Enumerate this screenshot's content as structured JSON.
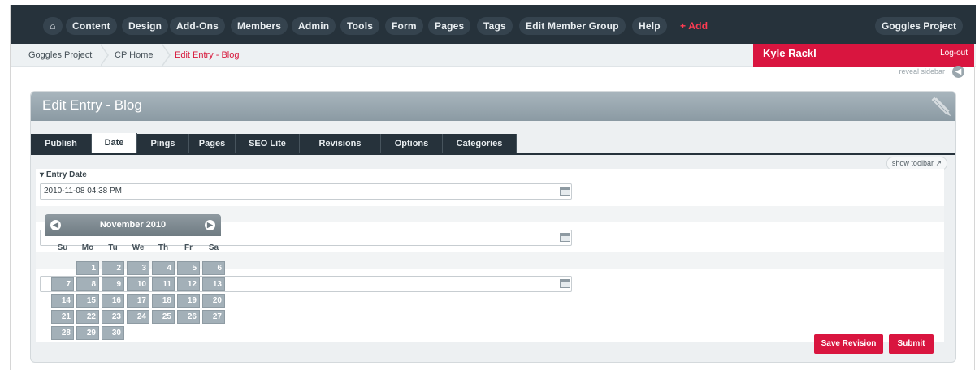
{
  "topnav": {
    "home_icon": "home-icon",
    "items": [
      "Content",
      "Design",
      "Add-Ons",
      "Members",
      "Admin",
      "Tools",
      "Form",
      "Pages",
      "Tags",
      "Edit Member Group",
      "Help"
    ],
    "add_label": "+ Add",
    "project": "Goggles Project"
  },
  "breadcrumb": [
    "Goggles Project",
    "CP Home",
    "Edit Entry - Blog"
  ],
  "user": {
    "name": "Kyle Rackl",
    "logout": "Log-out"
  },
  "reveal_sidebar": "reveal sidebar",
  "panel": {
    "title": "Edit Entry - Blog"
  },
  "tabs": [
    "Publish",
    "Date",
    "Pings",
    "Pages",
    "SEO Lite",
    "Revisions",
    "Options",
    "Categories"
  ],
  "active_tab": "Date",
  "show_toolbar": "show toolbar",
  "entry_date": {
    "label": "Entry Date",
    "value": "2010-11-08 04:38 PM"
  },
  "datepicker": {
    "title": "November 2010",
    "weekdays": [
      "Su",
      "Mo",
      "Tu",
      "We",
      "Th",
      "Fr",
      "Sa"
    ],
    "days": [
      "1",
      "2",
      "3",
      "4",
      "5",
      "6",
      "7",
      "8",
      "9",
      "10",
      "11",
      "12",
      "13",
      "14",
      "15",
      "16",
      "17",
      "18",
      "19",
      "20",
      "21",
      "22",
      "23",
      "24",
      "25",
      "26",
      "27",
      "28",
      "29",
      "30"
    ]
  },
  "buttons": {
    "save_revision": "Save Revision",
    "submit": "Submit"
  },
  "colors": {
    "nav_bg": "#26323b",
    "accent": "#d9153f",
    "panel_head": "#9aa8b0"
  }
}
